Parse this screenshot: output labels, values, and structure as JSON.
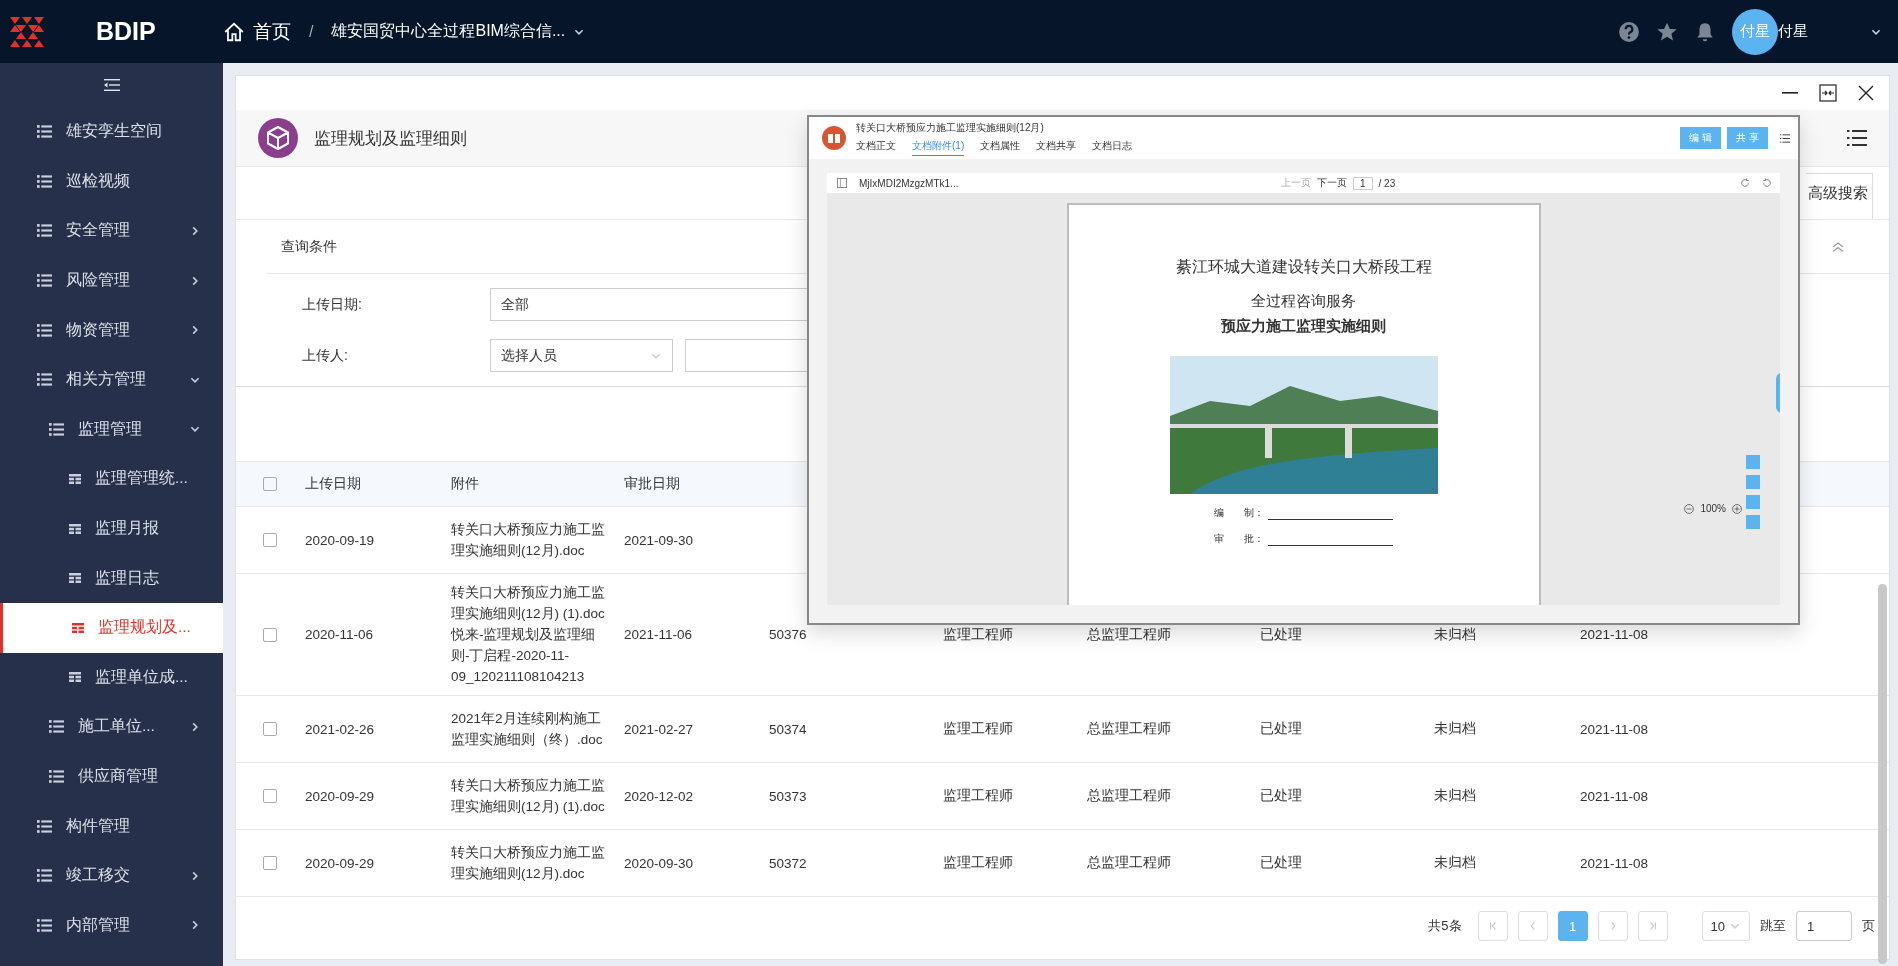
{
  "topbar": {
    "brand": "BDIP",
    "breadcrumb": [
      {
        "label": "首页",
        "kind": "home"
      },
      {
        "label": "雄安国贸中心全过程BIM综合信...",
        "kind": "project"
      }
    ],
    "separator": "/",
    "user": {
      "avatar_text": "付星",
      "name": "付星"
    }
  },
  "sidebar": {
    "items": [
      {
        "label": "雄安孪生空间",
        "kind": "list"
      },
      {
        "label": "巡检视频",
        "kind": "list"
      },
      {
        "label": "安全管理",
        "kind": "list",
        "expanded": false
      },
      {
        "label": "风险管理",
        "kind": "list",
        "expanded": false
      },
      {
        "label": "物资管理",
        "kind": "list",
        "expanded": false
      },
      {
        "label": "相关方管理",
        "kind": "list",
        "expanded": true,
        "children": [
          {
            "label": "监理管理",
            "kind": "list",
            "expanded": true,
            "children": [
              {
                "label": "监理管理统...",
                "kind": "page",
                "selected": false
              },
              {
                "label": "监理月报",
                "kind": "page",
                "selected": false
              },
              {
                "label": "监理日志",
                "kind": "page",
                "selected": false
              },
              {
                "label": "监理规划及...",
                "kind": "page",
                "selected": true
              },
              {
                "label": "监理单位成...",
                "kind": "page",
                "selected": false
              }
            ]
          },
          {
            "label": "施工单位...",
            "kind": "list",
            "expanded": false
          },
          {
            "label": "供应商管理",
            "kind": "list"
          }
        ]
      },
      {
        "label": "构件管理",
        "kind": "list"
      },
      {
        "label": "竣工移交",
        "kind": "list",
        "expanded": false
      },
      {
        "label": "内部管理",
        "kind": "list",
        "expanded": false
      }
    ]
  },
  "page": {
    "title": "监理规划及监理细则",
    "advanced_search_tab": "高级搜索",
    "query": {
      "title": "查询条件",
      "fields": [
        {
          "label": "上传日期:",
          "kind": "text",
          "value": "全部"
        },
        {
          "label": "上传人:",
          "kind": "select",
          "value": "选择人员"
        }
      ]
    },
    "table": {
      "all_selected": false,
      "columns": [
        "上传日期",
        "附件",
        "审批日期"
      ],
      "rows": [
        {
          "selected": false,
          "cells": [
            "2020-09-19",
            "转关口大桥预应力施工监理实施细则(12月).doc",
            "2021-09-30"
          ]
        },
        {
          "selected": false,
          "cells": [
            "2020-11-06",
            "转关口大桥预应力施工监理实施细则(12月) (1).doc\n悦来-监理规划及监理细则-丁启程-2020-11-09_120211108104213",
            "2021-11-06",
            "50376",
            "监理工程师",
            "总监理工程师",
            "已处理",
            "未归档",
            "2021-11-08"
          ]
        },
        {
          "selected": false,
          "cells": [
            "2021-02-26",
            "2021年2月连续刚构施工监理实施细则（终）.doc",
            "2021-02-27",
            "50374",
            "监理工程师",
            "总监理工程师",
            "已处理",
            "未归档",
            "2021-11-08"
          ]
        },
        {
          "selected": false,
          "cells": [
            "2020-09-29",
            "转关口大桥预应力施工监理实施细则(12月) (1).doc",
            "2020-12-02",
            "50373",
            "监理工程师",
            "总监理工程师",
            "已处理",
            "未归档",
            "2021-11-08"
          ]
        },
        {
          "selected": false,
          "cells": [
            "2020-09-29",
            "转关口大桥预应力施工监理实施细则(12月).doc",
            "2020-09-30",
            "50372",
            "监理工程师",
            "总监理工程师",
            "已处理",
            "未归档",
            "2021-11-08"
          ]
        }
      ]
    },
    "pagination": {
      "total": "共5条",
      "pages": [
        {
          "label": "1",
          "selected": true
        }
      ],
      "page_size": "10",
      "jump_label": "跳至",
      "jump_value": "1",
      "page_unit": "页"
    }
  },
  "preview": {
    "title": "转关口大桥预应力施工监理实施细则(12月)",
    "tabs": [
      {
        "label": "文档正文",
        "selected": false
      },
      {
        "label": "文档附件(1)",
        "selected": true
      },
      {
        "label": "文档属性",
        "selected": false
      },
      {
        "label": "文档共享",
        "selected": false
      },
      {
        "label": "文档日志",
        "selected": false
      }
    ],
    "buttons": [
      "编 辑",
      "共 享"
    ],
    "viewer": {
      "file_name": "MjIxMDI2MzgzMTk1...",
      "prev": "上一页",
      "next": "下一页",
      "page": "1",
      "page_total": "/ 23",
      "zoom": "100%"
    },
    "document": {
      "heading": "綦江环城大道建设转关口大桥段工程",
      "subtitle": "全过程咨询服务",
      "title": "预应力施工监理实施细则",
      "sign_lines": [
        "编　　制：",
        "审　　批："
      ]
    }
  }
}
